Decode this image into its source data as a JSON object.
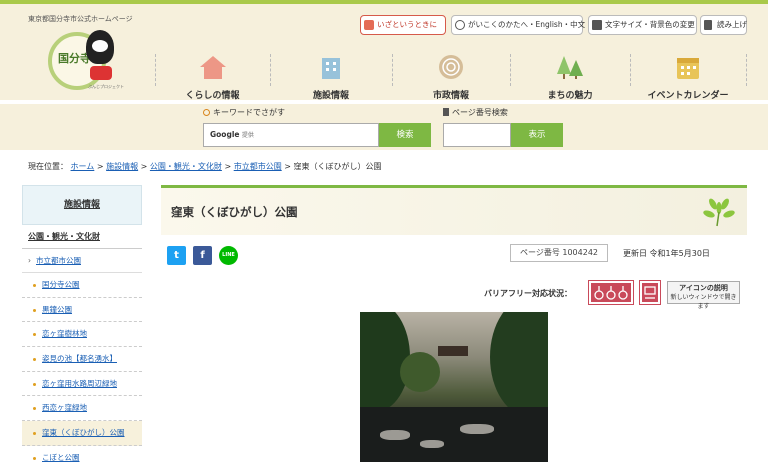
{
  "header": {
    "site_name": "東京都国分寺市公式ホームページ",
    "logo_text": "国分寺",
    "logo_sub": "ぶんじプロジェクト",
    "util": {
      "emergency": "いざというときに",
      "language": "がいこくのかたへ・English・中文",
      "text_size": "文字サイズ・背景色の変更",
      "read_aloud": "読み上げ"
    },
    "nav": [
      {
        "label": "くらしの情報",
        "icon": "house-icon",
        "color": "#e97a6a"
      },
      {
        "label": "施設情報",
        "icon": "building-icon",
        "color": "#7fb7d9"
      },
      {
        "label": "市政情報",
        "icon": "tree-ring-icon",
        "color": "#c8a77a"
      },
      {
        "label": "まちの魅力",
        "icon": "trees-icon",
        "color": "#8fc46a"
      },
      {
        "label": "イベントカレンダー",
        "icon": "calendar-icon",
        "color": "#e8c458"
      }
    ]
  },
  "search": {
    "keyword_label": "キーワードでさがす",
    "google_brand": "Google",
    "google_suffix": "提供",
    "search_button": "検索",
    "page_label": "ページ番号検索",
    "page_button": "表示"
  },
  "breadcrumb": {
    "prefix": "現在位置：",
    "items": [
      "ホーム",
      "施設情報",
      "公園・観光・文化財",
      "市立都市公園"
    ],
    "separator": ">",
    "current": "窪東（くぼひがし）公園"
  },
  "sidebar": {
    "heading": "施設情報",
    "category": "公園・観光・文化財",
    "subcategory": "市立都市公園",
    "items": [
      "国分寺公園",
      "黒鐘公園",
      "恋ヶ窪樹林地",
      "姿見の池【都名湧水】",
      "恋ヶ窪用水路周辺緑地",
      "西恋ヶ窪緑地",
      "窪東（くぼひがし）公園",
      "こぼと公園"
    ],
    "active_index": 6
  },
  "main": {
    "title": "窪東（くぼひがし）公園",
    "share": {
      "twitter": "t",
      "facebook": "f",
      "line": "LINE"
    },
    "page_number_label": "ページ番号",
    "page_number": "1004242",
    "updated_label": "更新日",
    "updated_date": "令和1年5月30日",
    "barrier_free_label": "バリアフリー対応状況：",
    "icon_help_title": "アイコンの説明",
    "icon_help_sub": "新しいウィンドウで開きます"
  },
  "colors": {
    "accent_green": "#7eb843",
    "header_bg": "#f6f0dc",
    "link_blue": "#1a5fb4",
    "barrier_red": "#c94a5a"
  }
}
